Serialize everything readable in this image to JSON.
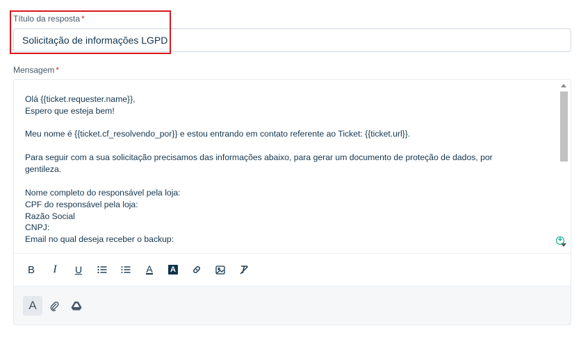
{
  "form": {
    "title_label": "Título da resposta",
    "title_required": "*",
    "title_value": "Solicitação de informações LGPD",
    "message_label": "Mensagem",
    "message_required": "*"
  },
  "message": {
    "lines": [
      "Olá {{ticket.requester.name}},",
      "Espero que esteja bem!",
      "",
      "Meu nome é {{ticket.cf_resolvendo_por}} e estou entrando em contato referente ao Ticket: {{ticket.url}}.",
      "",
      "Para seguir com a sua solicitação precisamos das informações abaixo, para gerar um documento de proteção de dados, por",
      "gentileza.",
      "",
      "Nome completo do responsável pela loja:",
      "CPF do responsável pela loja:",
      "Razão Social",
      "CNPJ:",
      "Email no qual deseja receber o backup:"
    ]
  },
  "toolbar": {
    "bold": "B",
    "italic": "I",
    "underline": "U",
    "ordered_list": "ordered-list-icon",
    "bullet_list": "bullet-list-icon",
    "font_color": "A",
    "highlight_color": "A",
    "link": "link-icon",
    "image": "image-icon",
    "clear_format": "clear-format-icon"
  },
  "footer": {
    "format": "A",
    "attach": "paperclip-icon",
    "drive": "google-drive-icon"
  },
  "colors": {
    "required": "#d72d30",
    "highlight_box": "#d9161c",
    "text": "#12344d",
    "add_icon": "#00a886"
  }
}
